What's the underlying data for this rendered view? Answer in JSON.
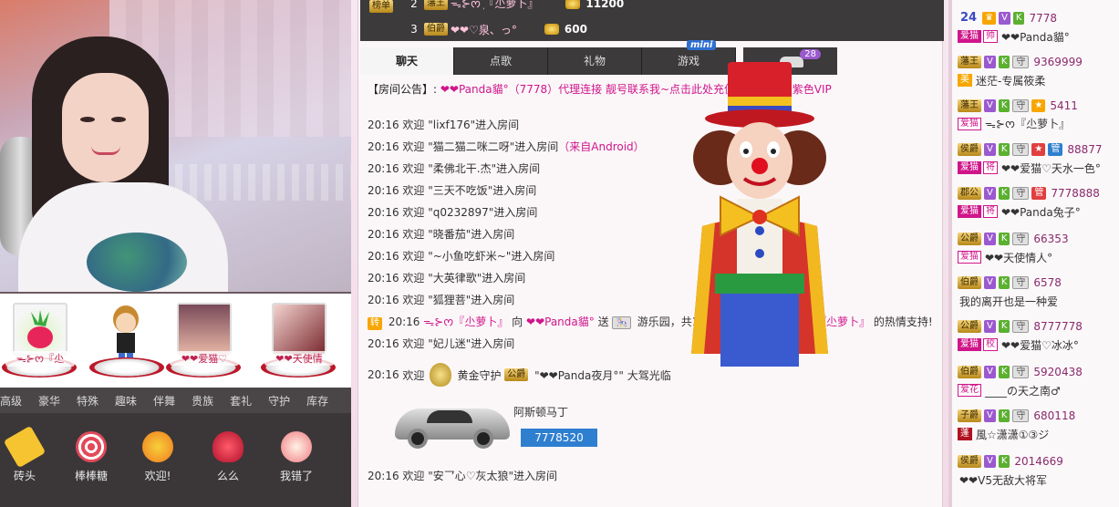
{
  "ranking": [
    {
      "num": "2",
      "title": "藩王",
      "name": "ᯓ⊱ᰔ ᷂『尐萝卜』",
      "score": "11200"
    },
    {
      "num": "3",
      "title": "伯爵",
      "name": "❤❤♡泉、っ°",
      "score": "600"
    }
  ],
  "rank_tag": "榜单",
  "chat_tabs": [
    "聊天",
    "点歌",
    "礼物",
    "游戏"
  ],
  "car_tab_count": "28",
  "mini_label": "mini",
  "notice": {
    "prefix": "【房间公告】:",
    "text": "❤❤Panda貓°（7778）代理连接 靓号联系我~点击此处充值,首充100送紫色VIP"
  },
  "chat": [
    {
      "time": "20:16",
      "text": "欢迎 \"lixf176\"进入房间"
    },
    {
      "time": "20:16",
      "text": "欢迎 \"猫二猫二咪二呀\"进入房间",
      "extra": "（来自Android）"
    },
    {
      "time": "20:16",
      "text": "欢迎 \"柔佛北干.杰\"进入房间"
    },
    {
      "time": "20:16",
      "text": "欢迎 \"三天不吃饭\"进入房间"
    },
    {
      "time": "20:16",
      "text": "欢迎 \"q0232897\"进入房间"
    },
    {
      "time": "20:16",
      "text": "欢迎 \"晓番茄\"进入房间"
    },
    {
      "time": "20:16",
      "text": "欢迎 \"~小鱼吃虾米~\"进入房间"
    },
    {
      "time": "20:16",
      "text": "欢迎 \"大英律歌\"进入房间"
    },
    {
      "time": "20:16",
      "text": "欢迎 \"狐狸菩\"进入房间"
    }
  ],
  "broadcast": {
    "badge": "转",
    "time": "20:16",
    "from": "ᯓ⊱ᰔ『尐萝卜』",
    "verb1": "向",
    "to": "❤❤Panda貓°",
    "verb2": "送",
    "gift": "游乐园，共1",
    "to2": "『尐萝卜』",
    "thanks": "的热情支持!"
  },
  "chat2": {
    "time": "20:16",
    "text": "欢迎 \"妃儿迷\"进入房间"
  },
  "vip": {
    "time": "20:16",
    "welcome": "欢迎",
    "role": "黄金守护",
    "title": "公爵",
    "name": "\"❤❤Panda夜月°\"",
    "action": "大驾光临"
  },
  "car": {
    "name": "阿斯顿马丁",
    "id": "7778520"
  },
  "last_msg": {
    "time": "20:16",
    "text": "欢迎 \"安乛心♡灰太狼\"进入房间"
  },
  "guards": [
    {
      "name": "ᯓ⊱ᰔ『尐"
    },
    {
      "name": ""
    },
    {
      "name": "❤❤爱猫♡"
    },
    {
      "name": "❤❤天使情"
    }
  ],
  "gift_tabs": [
    "高级",
    "豪华",
    "特殊",
    "趣味",
    "伴舞",
    "贵族",
    "套礼",
    "守护",
    "库存"
  ],
  "gifts": [
    {
      "label": "砖头",
      "color": "#f5c430"
    },
    {
      "label": "棒棒糖",
      "color": "#e24a5a"
    },
    {
      "label": "欢迎!",
      "color": "#f0a030"
    },
    {
      "label": "么么",
      "color": "#d0203a"
    },
    {
      "label": "我错了",
      "color": "#f07a80"
    }
  ],
  "users": [
    {
      "id": "7778",
      "tags": [
        "24",
        "♛",
        "V",
        "K"
      ],
      "rtag": "爱猫",
      "ttag": "帅",
      "name": "❤❤Panda貓°"
    },
    {
      "id": "9369999",
      "tags": [
        "藩王",
        "V",
        "K",
        "守"
      ],
      "rtag": "美",
      "ttag": "",
      "name": "迷茫-专属筱柔"
    },
    {
      "id": "5411",
      "tags": [
        "藩王",
        "V",
        "K",
        "守",
        "★"
      ],
      "rtag": "爱猫",
      "ttag": "",
      "name": "ᯓ⊱ᰔ『尐萝卜』"
    },
    {
      "id": "88877",
      "tags": [
        "侯爵",
        "V",
        "K",
        "守",
        "★",
        "管"
      ],
      "rtag": "爱猫",
      "ttag": "将",
      "name": "❤❤爱猫♡天水一色°"
    },
    {
      "id": "7778888",
      "tags": [
        "郡公",
        "V",
        "K",
        "守",
        "管"
      ],
      "rtag": "爱猫",
      "ttag": "将",
      "name": "❤❤Panda兔子°"
    },
    {
      "id": "66353",
      "tags": [
        "公爵",
        "V",
        "K",
        "守"
      ],
      "rtag": "爱猫",
      "ttag": "",
      "name": "❤❤天使情人°"
    },
    {
      "id": "6578",
      "tags": [
        "伯爵",
        "V",
        "K",
        "守"
      ],
      "rtag": "",
      "ttag": "",
      "name": "我的离开也是一种爱"
    },
    {
      "id": "8777778",
      "tags": [
        "公爵",
        "V",
        "K",
        "守"
      ],
      "rtag": "爱猫",
      "ttag": "校",
      "name": "❤❤爱猫♡冰冰°"
    },
    {
      "id": "5920438",
      "tags": [
        "伯爵",
        "V",
        "K",
        "守"
      ],
      "rtag": "爱花",
      "ttag": "",
      "name": "____の天之南♂"
    },
    {
      "id": "680118",
      "tags": [
        "子爵",
        "V",
        "K",
        "守"
      ],
      "rtag": "蓬",
      "ttag": "",
      "name": "風☆潇潇①③ジ"
    },
    {
      "id": "2014669",
      "tags": [
        "侯爵",
        "V",
        "K"
      ],
      "rtag": "",
      "ttag": "",
      "name": "❤❤V5无敌大将军"
    }
  ]
}
